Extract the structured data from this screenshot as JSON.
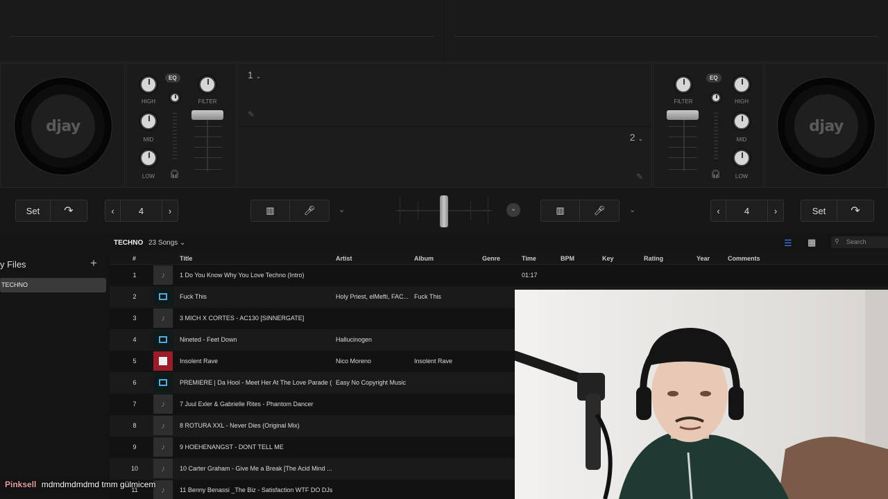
{
  "decks": {
    "left": {
      "logo": "djay",
      "knobs": {
        "high": "HIGH",
        "mid": "MID",
        "low": "LOW",
        "filter": "FILTER"
      },
      "eq_label": "EQ"
    },
    "right": {
      "logo": "djay",
      "knobs": {
        "high": "HIGH",
        "mid": "MID",
        "low": "LOW",
        "filter": "FILTER"
      },
      "eq_label": "EQ"
    }
  },
  "center": {
    "deck1": "1",
    "deck2": "2"
  },
  "controls": {
    "left": {
      "set_label": "Set",
      "loop_value": "4"
    },
    "right": {
      "set_label": "Set",
      "loop_value": "4"
    }
  },
  "library": {
    "sidebar_title": "y Files",
    "add_icon": "plus-icon",
    "selected_playlist": "TECHNO",
    "playlist_name": "TECHNO",
    "song_count": "23 Songs",
    "search_placeholder": "Search",
    "columns": [
      "#",
      "Title",
      "Artist",
      "Album",
      "Genre",
      "Time",
      "BPM",
      "Key",
      "Rating",
      "Year",
      "Comments"
    ],
    "rows": [
      {
        "num": "1",
        "title": "1 Do You Know Why You Love Techno (Intro)",
        "artist": "",
        "album": "",
        "time": "01:17",
        "thumb": "note"
      },
      {
        "num": "2",
        "title": "Fuck This",
        "artist": "Holy Priest, elMefti, FAC...",
        "album": "Fuck This",
        "time": "",
        "thumb": "art"
      },
      {
        "num": "3",
        "title": "3 MICH X CORTES - AC130 [SINNERGATE]",
        "artist": "",
        "album": "",
        "time": "",
        "thumb": "note"
      },
      {
        "num": "4",
        "title": "Nineted - Feet Down",
        "artist": "Hallucinogen",
        "album": "",
        "time": "",
        "thumb": "art"
      },
      {
        "num": "5",
        "title": "Insolent Rave",
        "artist": "Nico Moreno",
        "album": "Insolent Rave",
        "time": "",
        "thumb": "art-red"
      },
      {
        "num": "6",
        "title": "PREMIERE | Da Hool - Meet Her At The Love Parade (...",
        "artist": "Easy No Copyright Music",
        "album": "",
        "time": "",
        "thumb": "art"
      },
      {
        "num": "7",
        "title": "7 Juul Exler & Gabrielle Rites -  Phantom Dancer",
        "artist": "",
        "album": "",
        "time": "",
        "thumb": "note"
      },
      {
        "num": "8",
        "title": "8 ROTURA XXL - Never Dies (Original Mix)",
        "artist": "",
        "album": "",
        "time": "",
        "thumb": "note"
      },
      {
        "num": "9",
        "title": "9 HOEHENANGST - DONT TELL ME",
        "artist": "",
        "album": "",
        "time": "",
        "thumb": "note"
      },
      {
        "num": "10",
        "title": "10 Carter Graham - Give Me a  Break [The Acid Mind ...",
        "artist": "",
        "album": "",
        "time": "",
        "thumb": "note"
      },
      {
        "num": "11",
        "title": "11 Benny Benassi _The Biz - Satisfaction WTF DO DJs ...",
        "artist": "",
        "album": "",
        "time": "",
        "thumb": "note"
      }
    ]
  },
  "chat": {
    "user": "Pinksell",
    "message": "mdmdmdmdmd tmm gülmicem"
  },
  "colors": {
    "accent": "#3b82f6",
    "chat_user": "#e8a0a0"
  }
}
